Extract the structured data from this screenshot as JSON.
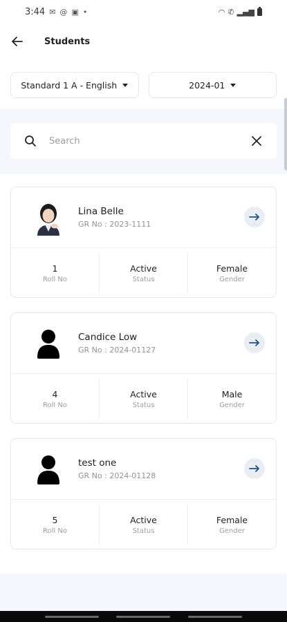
{
  "status_bar": {
    "time": "3:44"
  },
  "header": {
    "title": "Students"
  },
  "filters": {
    "class_label": "Standard 1 A - English",
    "period_label": "2024-01"
  },
  "search": {
    "placeholder": "Search",
    "value": ""
  },
  "students": [
    {
      "name": "Lina Belle",
      "gr": "GR No : 2023-1111",
      "roll": "1",
      "roll_label": "Roll No",
      "status": "Active",
      "status_label": "Status",
      "gender": "Female",
      "gender_label": "Gender",
      "avatar": "photo"
    },
    {
      "name": "Candice Low",
      "gr": "GR No : 2024-01127",
      "roll": "4",
      "roll_label": "Roll No",
      "status": "Active",
      "status_label": "Status",
      "gender": "Male",
      "gender_label": "Gender",
      "avatar": "person-icon"
    },
    {
      "name": "test one",
      "gr": "GR No : 2024-01128",
      "roll": "5",
      "roll_label": "Roll No",
      "status": "Active",
      "status_label": "Status",
      "gender": "Female",
      "gender_label": "Gender",
      "avatar": "person-icon"
    }
  ],
  "colors": {
    "accent": "#1f4f8a",
    "surface": "#f5f7fc",
    "arrow_bg": "#eaedf3"
  }
}
